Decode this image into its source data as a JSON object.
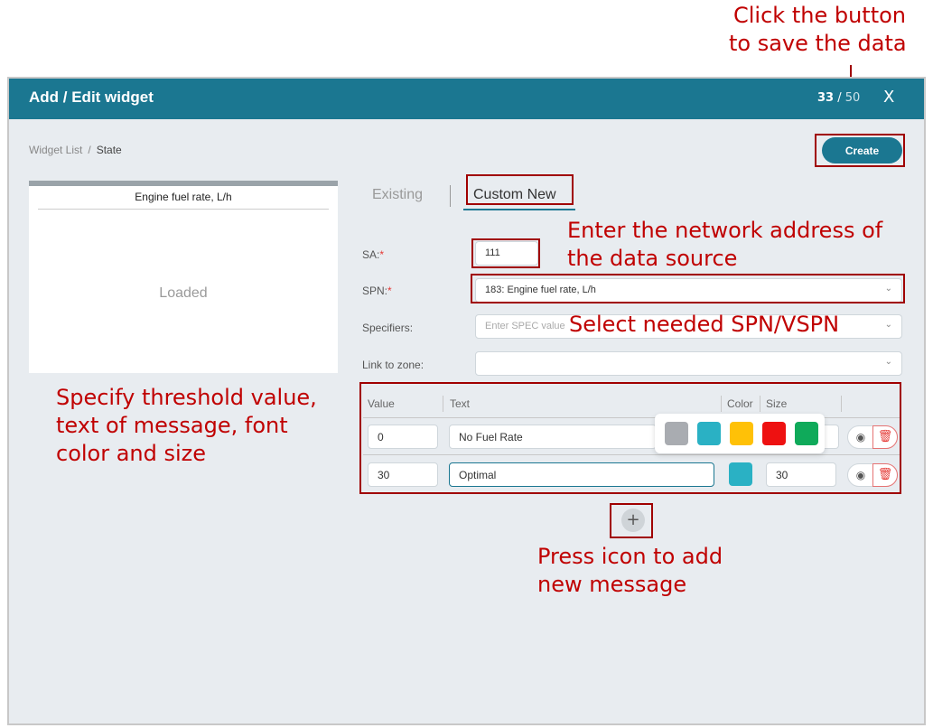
{
  "annotations": {
    "save_line1": "Click the button",
    "save_line2": "to save the data",
    "network_line1": "Enter the network address of",
    "network_line2": "the data source",
    "spn": "Select needed SPN/VSPN",
    "threshold_line1": "Specify threshold value,",
    "threshold_line2": "text of message, font",
    "threshold_line3": "color and size",
    "add_line1": "Press icon to add",
    "add_line2": "new message"
  },
  "window": {
    "title": "Add / Edit widget",
    "counter_current": "33",
    "counter_sep": " / ",
    "counter_max": "50",
    "close_label": "X"
  },
  "breadcrumb": {
    "parent": "Widget List",
    "sep": "/",
    "current": "State"
  },
  "toolbar": {
    "create_label": "Create"
  },
  "preview": {
    "title": "Engine fuel rate, L/h",
    "status": "Loaded"
  },
  "tabs": {
    "existing": "Existing",
    "custom_new": "Custom New"
  },
  "form": {
    "sa_label": "SA:",
    "sa_value": "111",
    "spn_label": "SPN:",
    "spn_value": "183: Engine fuel rate, L/h",
    "specifiers_label": "Specifiers:",
    "specifiers_placeholder": "Enter SPEC value",
    "link_zone_label": "Link to zone:",
    "required_mark": "*",
    "chevron": "⌄"
  },
  "table": {
    "headers": {
      "value": "Value",
      "text": "Text",
      "color": "Color",
      "size": "Size"
    },
    "rows": [
      {
        "value": "0",
        "text": "No Fuel Rate",
        "size": ""
      },
      {
        "value": "30",
        "text": "Optimal",
        "size": "30",
        "color": "#2ab1c4"
      }
    ]
  },
  "palette": {
    "colors": [
      "#a9acb1",
      "#2ab1c4",
      "#ffc107",
      "#ee1111",
      "#0faa5a"
    ]
  },
  "icons": {
    "eye": "eye-icon",
    "trash": "trash-icon",
    "plus": "plus-icon",
    "close": "close-icon",
    "chevron": "chevron-down-icon"
  },
  "colors": {
    "brand": "#1b7791",
    "annotation": "#c00000"
  }
}
